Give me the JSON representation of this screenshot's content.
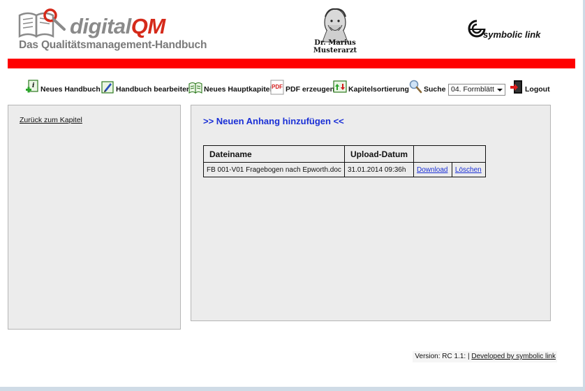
{
  "header": {
    "logo": {
      "word1": "digital",
      "word2": "QM",
      "subtitle": "Das Qualitätsmanagement-Handbuch"
    },
    "doctor": {
      "line1": "Dr. Marius",
      "line2": "Musterarzt"
    },
    "partner": {
      "name": "symbolic link"
    },
    "colors": {
      "bar": "#ff0000",
      "logo_accent": "#d52a1a",
      "logo_gray": "#8a8a8a"
    }
  },
  "toolbar": {
    "items": [
      {
        "label": "Neues Handbuch",
        "icon": "new-document-plus-icon"
      },
      {
        "label": "Handbuch bearbeiten",
        "icon": "edit-book-icon"
      },
      {
        "label": "Neues Hauptkapitel",
        "icon": "new-chapter-icon"
      },
      {
        "label": "PDF erzeugen",
        "icon": "pdf-icon"
      },
      {
        "label": "Kapitelsortierung",
        "icon": "sort-arrows-icon"
      },
      {
        "label": "Suche",
        "icon": "magnifier-icon"
      }
    ],
    "select_value": "04. Formblätt",
    "logout_label": "Logout"
  },
  "left": {
    "back_label": "Zurück zum Kapitel"
  },
  "main": {
    "add_label": ">> Neuen Anhang hinzufügen <<",
    "table": {
      "headers": [
        "Dateiname",
        "Upload-Datum",
        ""
      ],
      "rows": [
        {
          "file": "FB 001-V01 Fragebogen nach Epworth.doc",
          "date": "31.01.2014 09:36h",
          "download": "Download",
          "delete": "Löschen"
        }
      ]
    },
    "colors": {
      "link": "#1a2fd6",
      "panel": "#ececec"
    }
  },
  "footer": {
    "version": "Version: RC 1.1: |",
    "developer": "Developed by symbolic link"
  }
}
